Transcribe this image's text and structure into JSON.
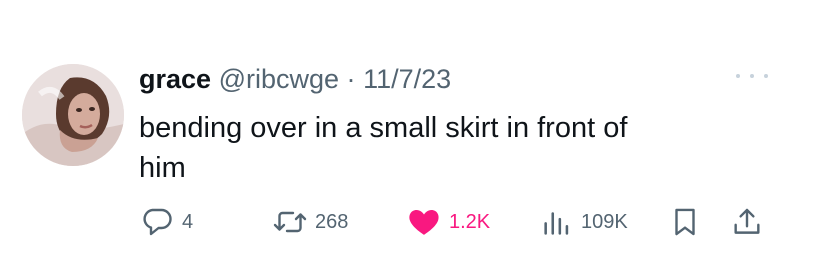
{
  "tweet": {
    "display_name": "grace",
    "handle": "@ribcwge",
    "separator": "·",
    "date": "11/7/23",
    "text_line1": "bending over in a small skirt in front of",
    "text_line2": "him",
    "more_icon": "more-horizontal-icon"
  },
  "actions": {
    "replies": "4",
    "reposts": "268",
    "likes": "1.2K",
    "views": "109K",
    "reply_icon": "reply-icon",
    "repost_icon": "repost-icon",
    "like_icon": "heart-icon",
    "views_icon": "views-icon",
    "bookmark_icon": "bookmark-icon",
    "share_icon": "share-icon"
  },
  "colors": {
    "text_primary": "#0f1419",
    "text_secondary": "#536471",
    "like_pink": "#f91880"
  }
}
